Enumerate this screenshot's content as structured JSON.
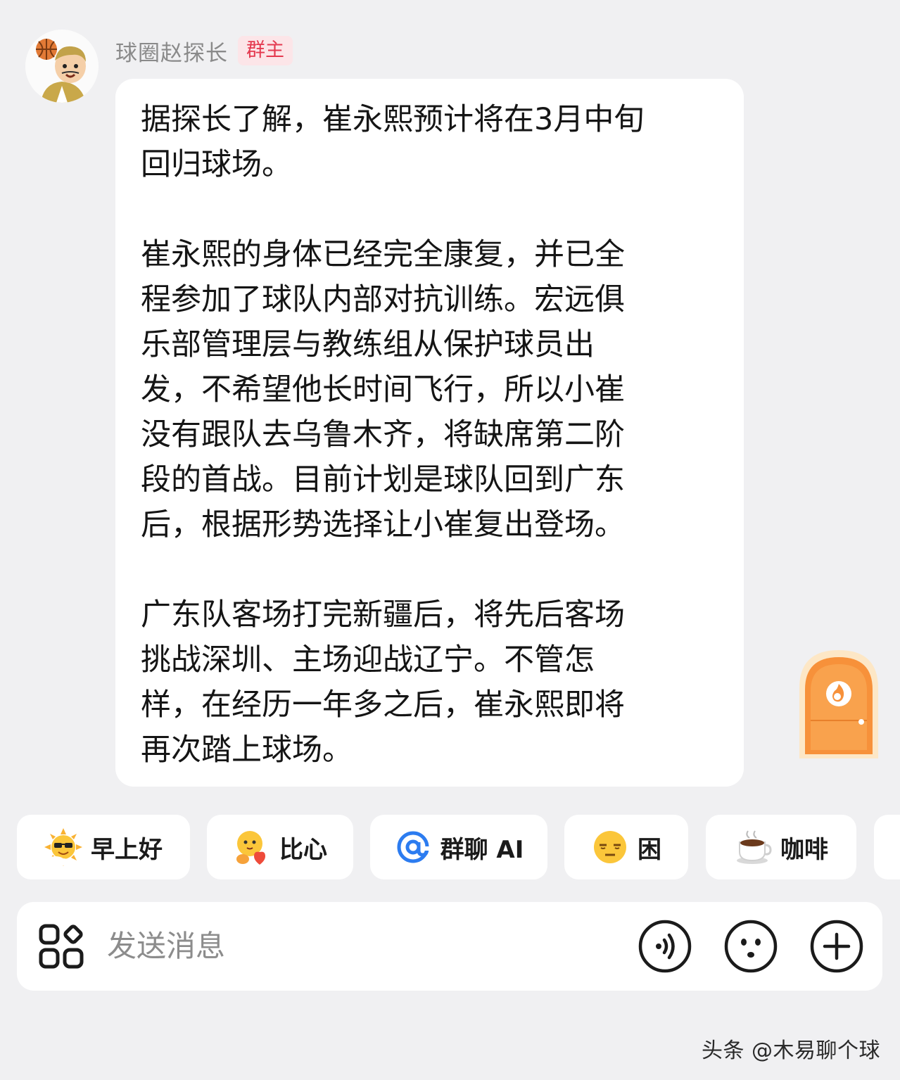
{
  "message": {
    "sender_name": "球圈赵探长",
    "sender_role": "群主",
    "text": "据探长了解，崔永熙预计将在3月中旬\n回归球场。\n\n崔永熙的身体已经完全康复，并已全\n程参加了球队内部对抗训练。宏远俱\n乐部管理层与教练组从保护球员出\n发，不希望他长时间飞行，所以小崔\n没有跟队去乌鲁木齐，将缺席第二阶\n段的首战。目前计划是球队回到广东\n后，根据形势选择让小崔复出登场。\n\n广东队客场打完新疆后，将先后客场\n挑战深圳、主场迎战辽宁。不管怎\n样，在经历一年多之后，崔永熙即将\n再次踏上球场。"
  },
  "quick_replies": [
    {
      "label": "早上好",
      "icon": "sun-sunglasses-icon"
    },
    {
      "label": "比心",
      "icon": "heart-hands-icon"
    },
    {
      "label": "群聊 AI",
      "icon": "at-icon"
    },
    {
      "label": "困",
      "icon": "sleepy-face-icon"
    },
    {
      "label": "咖啡",
      "icon": "coffee-icon"
    }
  ],
  "input": {
    "placeholder": "发送消息"
  },
  "watermark": "头条 @木易聊个球",
  "colors": {
    "background": "#f0f0f2",
    "bubble": "#ffffff",
    "badge_bg": "#fce5e8",
    "badge_text": "#e4394f",
    "at_blue": "#2c7cf0",
    "door_orange": "#f7913a"
  }
}
